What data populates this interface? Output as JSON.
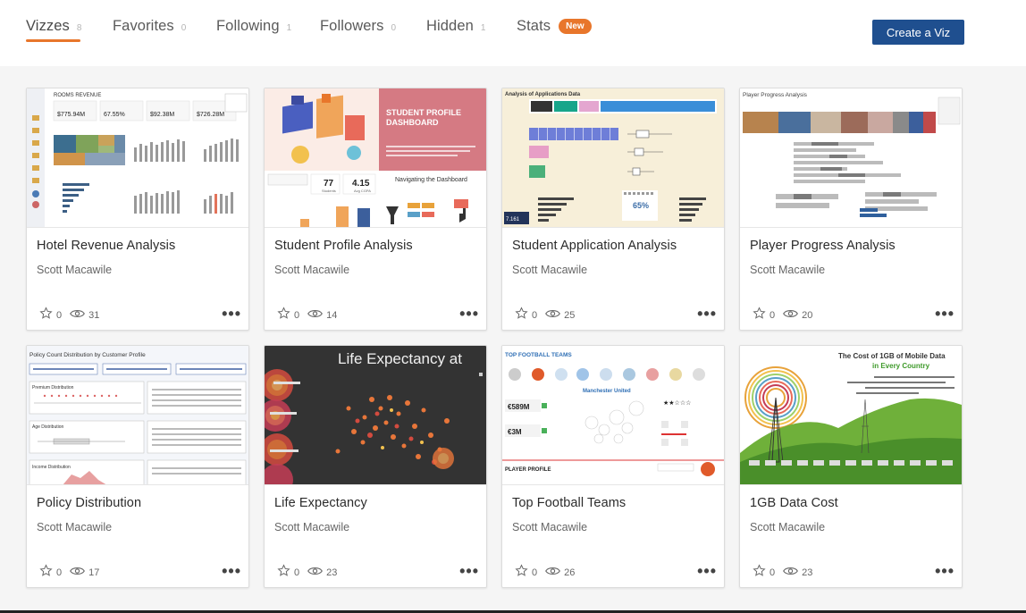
{
  "tabs": [
    {
      "label": "Vizzes",
      "count": "8"
    },
    {
      "label": "Favorites",
      "count": "0"
    },
    {
      "label": "Following",
      "count": "1"
    },
    {
      "label": "Followers",
      "count": "0"
    },
    {
      "label": "Hidden",
      "count": "1"
    },
    {
      "label": "Stats",
      "badge": "New"
    }
  ],
  "create_button": "Create a Viz",
  "colors": {
    "accent": "#e8762b",
    "primary_button": "#1f4f8f"
  },
  "cards": [
    {
      "title": "Hotel Revenue Analysis",
      "author": "Scott Macawile",
      "favorites": "0",
      "views": "31",
      "thumb": {
        "heading": "ROOMS REVENUE",
        "k1": "$775.94M",
        "k2": "67.55%",
        "k3": "$92.38M",
        "k4": "$726.28M"
      }
    },
    {
      "title": "Student Profile Analysis",
      "author": "Scott Macawile",
      "favorites": "0",
      "views": "14",
      "thumb": {
        "heading": "STUDENT PROFILE DASHBOARD",
        "k1": "77",
        "k1_label": "Students",
        "k2": "4.15",
        "k2_label": "Avg CGPA",
        "nav": "Navigating the Dashboard"
      }
    },
    {
      "title": "Student Application Analysis",
      "author": "Scott Macawile",
      "favorites": "0",
      "views": "25",
      "thumb": {
        "heading": "Analysis of Applications Data",
        "pct": "65%",
        "k1": "7.161"
      }
    },
    {
      "title": "Player Progress Analysis",
      "author": "Scott Macawile",
      "favorites": "0",
      "views": "20",
      "thumb": {
        "heading": "Player Progress Analysis"
      }
    },
    {
      "title": "Policy Distribution",
      "author": "Scott Macawile",
      "favorites": "0",
      "views": "17",
      "thumb": {
        "heading": "Policy Count Distribution by Customer Profile",
        "s1": "Premium Distribution",
        "s2": "Age Distribution",
        "s3": "Income Distribution"
      }
    },
    {
      "title": "Life Expectancy",
      "author": "Scott Macawile",
      "favorites": "0",
      "views": "23",
      "thumb": {
        "heading": "Life Expectancy at"
      }
    },
    {
      "title": "Top Football Teams",
      "author": "Scott Macawile",
      "favorites": "0",
      "views": "26",
      "thumb": {
        "heading": "TOP FOOTBALL TEAMS",
        "team": "Manchester United",
        "k1": "€589M",
        "k2": "€3M",
        "profile": "PLAYER PROFILE"
      }
    },
    {
      "title": "1GB Data Cost",
      "author": "Scott Macawile",
      "favorites": "0",
      "views": "23",
      "thumb": {
        "heading": "The Cost of 1GB of Mobile Data",
        "subheading": "in Every Country"
      }
    }
  ]
}
